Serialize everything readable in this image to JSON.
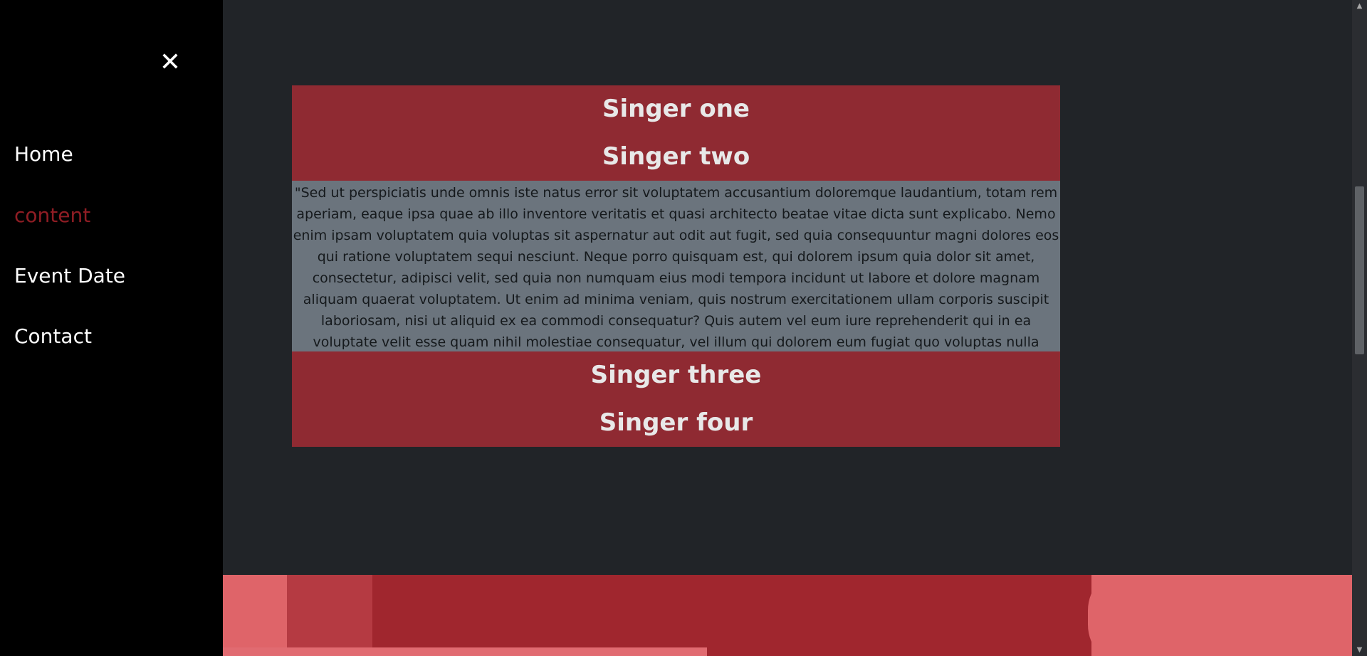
{
  "sidebar": {
    "close_label": "✕",
    "items": [
      {
        "label": "Home",
        "color": "#ffffff"
      },
      {
        "label": "content",
        "color": "#8f1d24"
      },
      {
        "label": "Event Date",
        "color": "#ffffff"
      },
      {
        "label": "Contact",
        "color": "#ffffff"
      }
    ]
  },
  "accordion": {
    "items": [
      {
        "title": "Singer one"
      },
      {
        "title": "Singer two",
        "expanded": true
      },
      {
        "title": "Singer three"
      },
      {
        "title": "Singer four"
      }
    ],
    "open_text": "\"Sed ut perspiciatis unde omnis iste natus error sit voluptatem accusantium doloremque laudantium, totam rem aperiam, eaque ipsa quae ab illo inventore veritatis et quasi architecto beatae vitae dicta sunt explicabo. Nemo enim ipsam voluptatem quia voluptas sit aspernatur aut odit aut fugit, sed quia consequuntur magni dolores eos qui ratione voluptatem sequi nesciunt. Neque porro quisquam est, qui dolorem ipsum quia dolor sit amet, consectetur, adipisci velit, sed quia non numquam eius modi tempora incidunt ut labore et dolore magnam aliquam quaerat voluptatem. Ut enim ad minima veniam, quis nostrum exercitationem ullam corporis suscipit laboriosam, nisi ut aliquid ex ea commodi consequatur? Quis autem vel eum iure reprehenderit qui in ea voluptate velit esse quam nihil molestiae consequatur, vel illum qui dolorem eum fugiat quo voluptas nulla pariatur?\""
  },
  "colors": {
    "accent": "#8f2a32",
    "active_nav": "#8f1d24",
    "panel": "#6b747d",
    "background": "#212428"
  },
  "scrollbar": {
    "up_arrow": "▲",
    "down_arrow": "▼"
  }
}
